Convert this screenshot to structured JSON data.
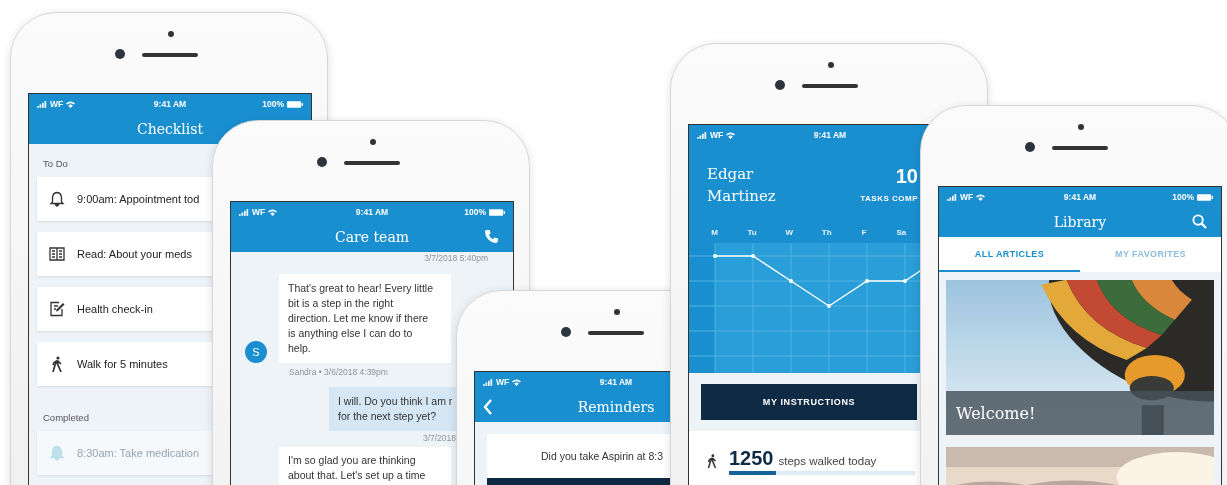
{
  "phones": [
    {
      "kind": "checklist",
      "status": {
        "carrier": "WF",
        "time": "9:41 AM",
        "battery": "100%"
      },
      "title": "Checklist",
      "sections": [
        {
          "heading": "To Do",
          "items": [
            {
              "kind": "bell",
              "text": "9:00am: Appointment tod",
              "done": false
            },
            {
              "kind": "book",
              "text": "Read: About your meds",
              "done": false
            },
            {
              "kind": "note",
              "text": "Health check-in",
              "done": false
            },
            {
              "kind": "walk",
              "text": "Walk for 5 minutes",
              "done": false
            }
          ]
        },
        {
          "heading": "Completed",
          "items": [
            {
              "kind": "bell",
              "text": "8:30am: Take medication",
              "done": true
            }
          ]
        }
      ]
    },
    {
      "kind": "chat",
      "status": {
        "carrier": "WF",
        "time": "9:41 AM",
        "battery": "100%"
      },
      "title": "Care team",
      "messages": [
        {
          "kind": "stamp",
          "lines": [
            "3/7/2018 5:40pm"
          ]
        },
        {
          "kind": "incoming",
          "avatar": "S",
          "lines": [
            "That's great to hear! Every little",
            "bit is a step in the right",
            "direction. Let me know if there",
            "is anything else I can do to",
            "help."
          ],
          "meta": "Sandra • 3/6/2018 4:39pm"
        },
        {
          "kind": "outgoing",
          "lines": [
            "I will. Do you think I am r",
            "for the next step yet?"
          ]
        },
        {
          "kind": "stamp",
          "lines": [
            "3/7/2018"
          ]
        },
        {
          "kind": "incoming",
          "lines": [
            "I'm so glad you are thinking",
            "about that. Let's set up a time"
          ]
        }
      ]
    },
    {
      "kind": "reminders",
      "status": {
        "carrier": "WF",
        "time": "9:41 AM"
      },
      "title": "Reminders",
      "card": "Did you take Aspirin at 8:3"
    },
    {
      "kind": "dashboard",
      "status": {
        "carrier": "WF",
        "time": "9:41 AM"
      },
      "name": "Edgar Martinez",
      "count": "10",
      "count_label": "TASKS COMP",
      "days": [
        "M",
        "Tu",
        "W",
        "Th",
        "F",
        "Sa"
      ],
      "button": "MY INSTRUCTIONS",
      "steps": {
        "value": "1250",
        "label": "steps walked today",
        "level": 0.25
      }
    },
    {
      "kind": "library",
      "status": {
        "carrier": "WF",
        "time": "9:41 AM",
        "battery": "100%"
      },
      "title": "Library",
      "tabs": [
        {
          "label": "ALL ARTICLES",
          "selected": true
        },
        {
          "label": "MY FAVORITES",
          "selected": false
        }
      ],
      "articles": [
        {
          "kind": "balloon",
          "title": "Welcome!"
        },
        {
          "kind": "sunset"
        }
      ]
    }
  ]
}
